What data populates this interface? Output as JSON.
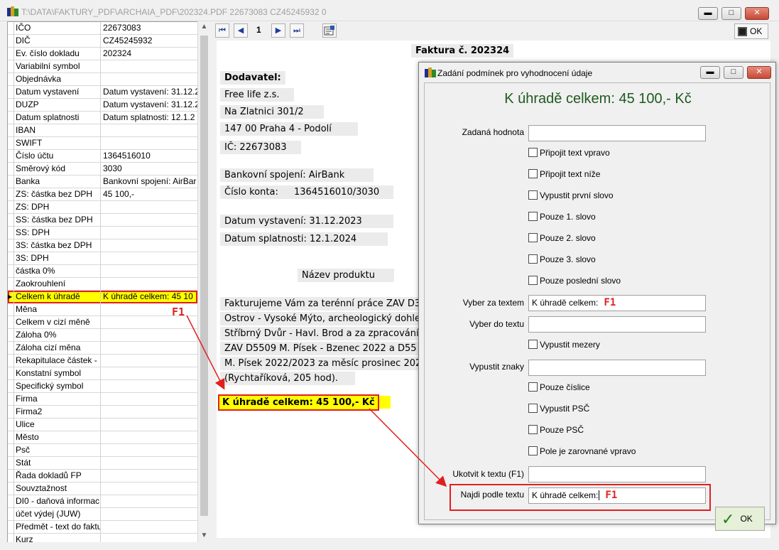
{
  "window": {
    "title": "T:\\DATA\\FAKTURY_PDF\\ARCHAIA_PDF\\202324.PDF 22673083 CZ45245932 0",
    "minimize": "▬",
    "maximize": "□",
    "close": "✕"
  },
  "grid": {
    "rows": [
      {
        "field": "IČO",
        "value": "22673083"
      },
      {
        "field": "DIČ",
        "value": "CZ45245932"
      },
      {
        "field": "Ev. číslo dokladu",
        "value": "202324"
      },
      {
        "field": "Variabilní symbol",
        "value": ""
      },
      {
        "field": "Objednávka",
        "value": ""
      },
      {
        "field": "Datum vystavení",
        "value": "Datum vystavení: 31.12.2"
      },
      {
        "field": "DUZP",
        "value": "Datum vystavení: 31.12.2"
      },
      {
        "field": "Datum splatnosti",
        "value": "Datum splatnosti: 12.1.2"
      },
      {
        "field": "IBAN",
        "value": ""
      },
      {
        "field": "SWIFT",
        "value": ""
      },
      {
        "field": "Číslo účtu",
        "value": "1364516010"
      },
      {
        "field": "Směrový kód",
        "value": "3030"
      },
      {
        "field": "Banka",
        "value": "Bankovní spojení: AirBar"
      },
      {
        "field": "ZS: částka bez DPH",
        "value": "45 100,-"
      },
      {
        "field": "ZS: DPH",
        "value": ""
      },
      {
        "field": "SS: částka bez DPH",
        "value": ""
      },
      {
        "field": "SS: DPH",
        "value": ""
      },
      {
        "field": "3S: částka bez DPH",
        "value": ""
      },
      {
        "field": "3S: DPH",
        "value": ""
      },
      {
        "field": "částka 0%",
        "value": ""
      },
      {
        "field": "Zaokrouhlení",
        "value": ""
      },
      {
        "field": "Celkem k úhradě",
        "value": "K úhradě celkem: 45 10"
      },
      {
        "field": "Měna",
        "value": ""
      },
      {
        "field": "Celkem v cizí měně",
        "value": ""
      },
      {
        "field": "Záloha 0%",
        "value": ""
      },
      {
        "field": "Záloha cizí měna",
        "value": ""
      },
      {
        "field": "Rekapitulace částek -",
        "value": ""
      },
      {
        "field": "Konstatní symbol",
        "value": ""
      },
      {
        "field": "Specifický symbol",
        "value": ""
      },
      {
        "field": "Firma",
        "value": ""
      },
      {
        "field": "Firma2",
        "value": ""
      },
      {
        "field": "Ulice",
        "value": ""
      },
      {
        "field": "Město",
        "value": ""
      },
      {
        "field": "Psč",
        "value": ""
      },
      {
        "field": "Stát",
        "value": ""
      },
      {
        "field": "Řada dokladů FP",
        "value": ""
      },
      {
        "field": "Souvztažnost",
        "value": ""
      },
      {
        "field": "DI0 - daňová informac",
        "value": ""
      },
      {
        "field": "účet výdej (JUW)",
        "value": ""
      },
      {
        "field": "Předmět - text do faktu",
        "value": ""
      },
      {
        "field": "Kurz",
        "value": ""
      }
    ]
  },
  "toolbar": {
    "page": "1",
    "first": "⏮",
    "prev": "◀",
    "next": "▶",
    "last": "⏭",
    "ok": "OK"
  },
  "invoice": {
    "title": "Faktura č. 202324",
    "supplier_label": "Dodavatel:",
    "supplier_name": "Free life z.s.",
    "street": "Na Zlatnici 301/2",
    "city": "147 00 Praha 4 - Podolí",
    "ic": "IČ: 22673083",
    "bank": "Bankovní spojení: AirBank",
    "account_label": "Číslo konta:",
    "account_value": "1364516010/3030",
    "issued": "Datum vystavení: 31.12.2023",
    "due": "Datum splatnosti: 12.1.2024",
    "product_header": "Název produktu",
    "text_lines": [
      "Fakturujeme Vám za terénní práce ZAV D3",
      "Ostrov - Vysoké Mýto, archeologický dohle",
      "Stříbrný Dvůr - Havl. Brod a za zpracování",
      "ZAV D5509 M. Písek - Bzenec 2022 a D55",
      "M. Písek 2022/2023 za měsíc prosinec 202",
      "(Rychtaříková, 205 hod)."
    ],
    "total": "K úhradě celkem: 45 100,- Kč"
  },
  "annotations": {
    "f1_grid": "F1",
    "f1_field": "F1",
    "f1_search": "F1"
  },
  "dialog": {
    "title": "Zadání podmínek pro vyhodnocení údaje",
    "heading": "K úhradě celkem: 45 100,- Kč",
    "zadana_hodnota_label": "Zadaná hodnota",
    "zadana_hodnota_value": "",
    "checks_top": [
      "Připojit text vpravo",
      "Připojit text níže",
      "Vypustit první slovo",
      "Pouze 1. slovo",
      "Pouze 2. slovo",
      "Pouze 3. slovo",
      "Pouze poslední slovo"
    ],
    "vyber_za_textem_label": "Vyber za textem",
    "vyber_za_textem_value": "K úhradě celkem:",
    "vyber_do_textu_label": "Vyber do textu",
    "vyber_do_textu_value": "",
    "vypustit_mezery": "Vypustit mezery",
    "vypustit_znaky_label": "Vypustit znaky",
    "vypustit_znaky_value": "",
    "checks_bottom": [
      "Pouze číslice",
      "Vypustit PSČ",
      "Pouze PSČ",
      "Pole je zarovnané vpravo"
    ],
    "ukotvit_label": "Ukotvit k textu (F1)",
    "ukotvit_value": "",
    "najdi_label": "Najdi podle textu",
    "najdi_value": "K úhradě celkem:",
    "ok": "OK"
  }
}
